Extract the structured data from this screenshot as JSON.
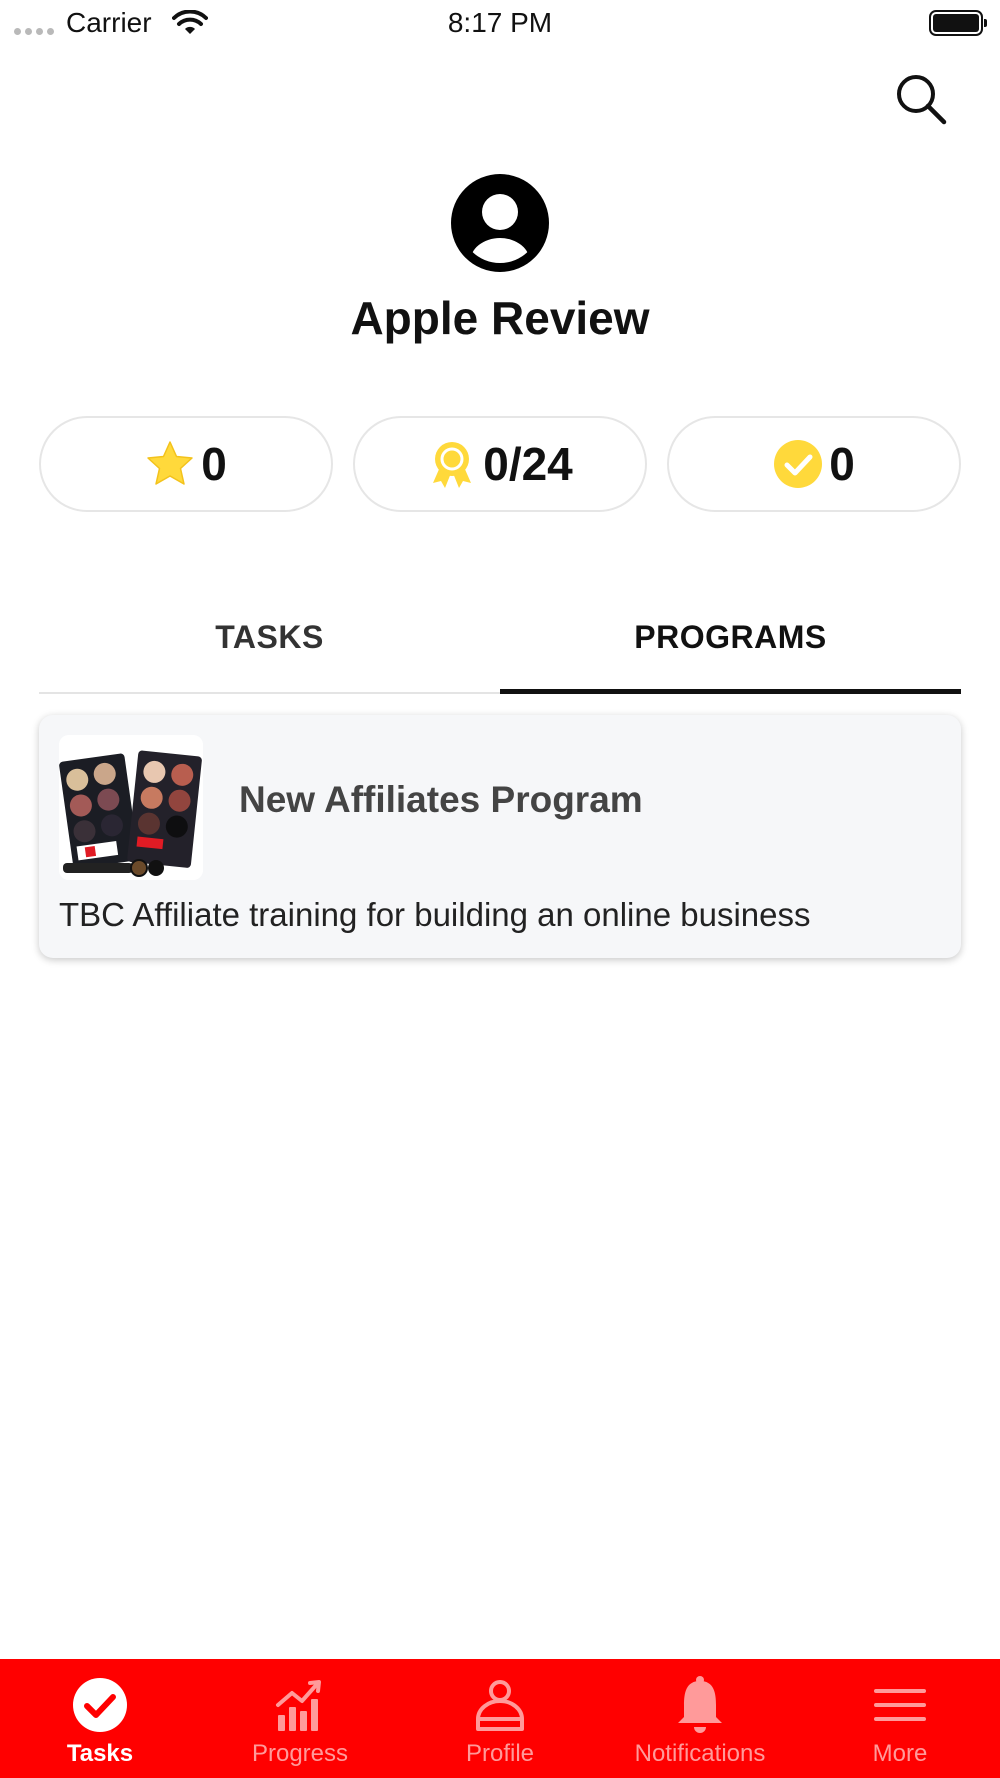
{
  "status_bar": {
    "carrier": "Carrier",
    "time": "8:17 PM"
  },
  "header": {
    "search_icon": "search-icon"
  },
  "profile": {
    "name": "Apple Review",
    "avatar_icon": "user-avatar-icon"
  },
  "stats": [
    {
      "icon": "star-icon",
      "value": "0",
      "color": "#FFD93B"
    },
    {
      "icon": "award-ribbon-icon",
      "value": "0/24",
      "color": "#FFD93B"
    },
    {
      "icon": "check-circle-icon",
      "value": "0",
      "color": "#FFD93B"
    }
  ],
  "tabs": [
    {
      "label": "TASKS",
      "active": false
    },
    {
      "label": "PROGRAMS",
      "active": true
    }
  ],
  "programs": [
    {
      "title": "New Affiliates Program",
      "description": "TBC Affiliate training for building an online business"
    }
  ],
  "tabbar": {
    "background": "#FF0000",
    "items": [
      {
        "label": "Tasks",
        "icon": "check-circle-icon",
        "active": true
      },
      {
        "label": "Progress",
        "icon": "bar-chart-icon",
        "active": false
      },
      {
        "label": "Profile",
        "icon": "person-icon",
        "active": false
      },
      {
        "label": "Notifications",
        "icon": "bell-icon",
        "active": false
      },
      {
        "label": "More",
        "icon": "menu-icon",
        "active": false
      }
    ]
  }
}
